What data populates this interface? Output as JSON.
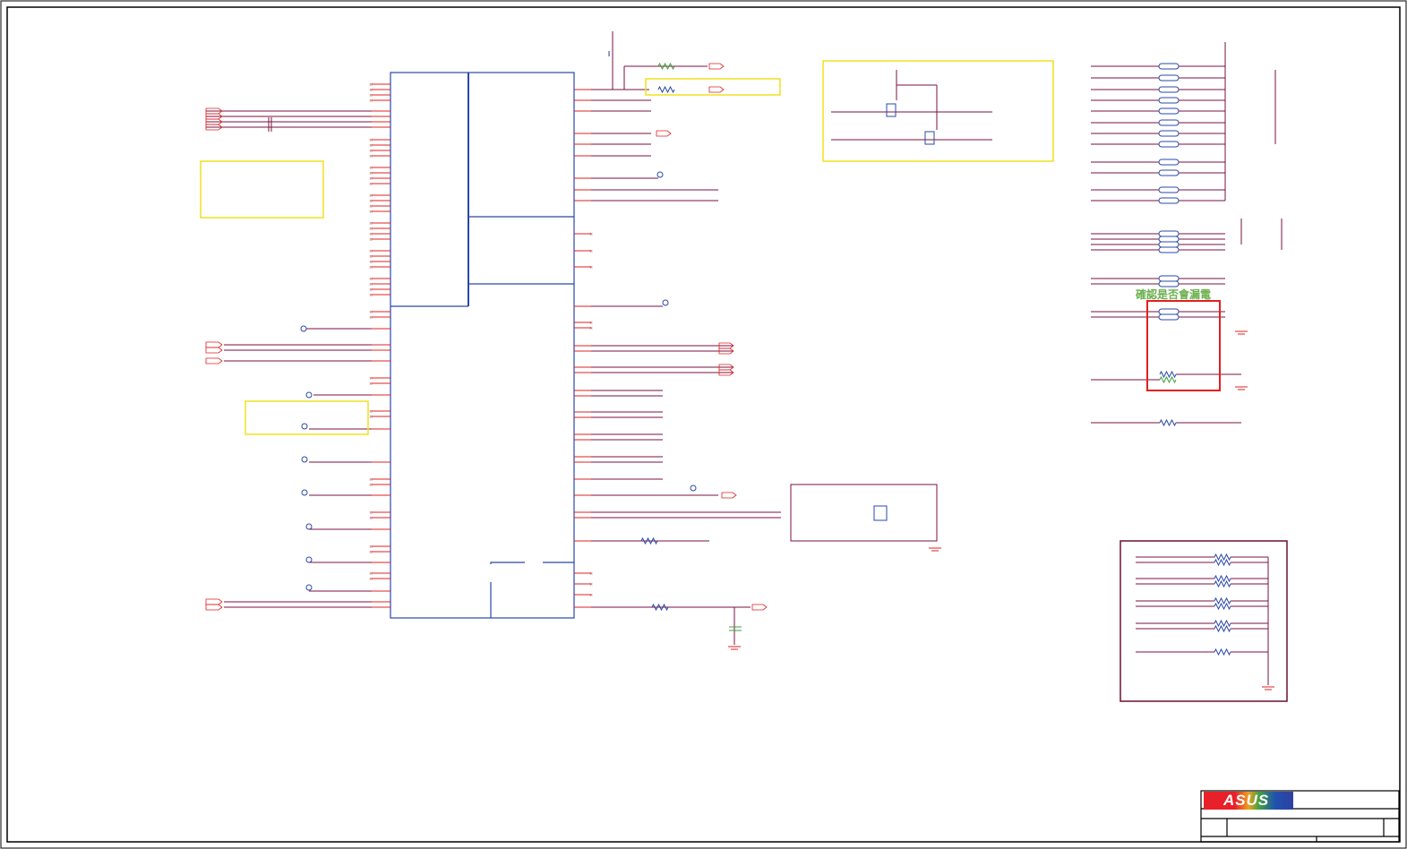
{
  "annotation": {
    "text": "確認是否會漏電"
  },
  "title_block": {
    "logo": "ASUS"
  },
  "colors": {
    "wire": "#7a1040",
    "pin": "#e02020",
    "chip": "#2a48a8",
    "highlight_box": "#f0e020",
    "warning_box": "#e02020",
    "note": "#6ab04c"
  }
}
